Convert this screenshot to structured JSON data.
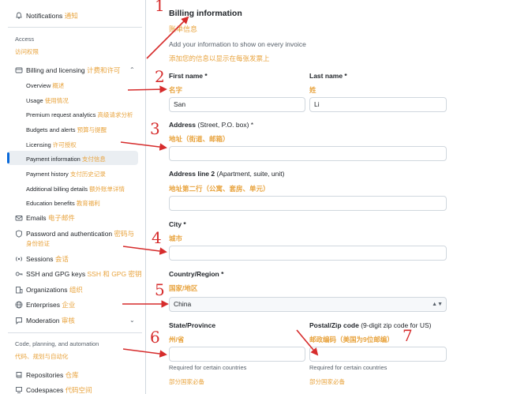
{
  "sidebar": {
    "top_item": {
      "label": "Notifications",
      "zh": "通知"
    },
    "access_heading": "Access",
    "access_heading_zh": "访问权限",
    "billing": {
      "label": "Billing and licensing",
      "zh": "计费和许可"
    },
    "billing_sub": [
      {
        "label": "Overview",
        "zh": "概述"
      },
      {
        "label": "Usage",
        "zh": "使用情况"
      },
      {
        "label": "Premium request analytics",
        "zh": "高级请求分析"
      },
      {
        "label": "Budgets and alerts",
        "zh": "预算与提醒"
      },
      {
        "label": "Licensing",
        "zh": "许可授权"
      },
      {
        "label": "Payment information",
        "zh": "支付信息"
      },
      {
        "label": "Payment history",
        "zh": "支付历史记录"
      },
      {
        "label": "Additional billing details",
        "zh": "额外账单详情"
      },
      {
        "label": "Education benefits",
        "zh": "教育福利"
      }
    ],
    "items": [
      {
        "label": "Emails",
        "zh": "电子邮件"
      },
      {
        "label": "Password and authentication",
        "zh": "密码与",
        "zh2": "身份验证"
      },
      {
        "label": "Sessions",
        "zh": "会话"
      },
      {
        "label": "SSH and GPG keys",
        "zh": "SSH 和 GPG 密钥"
      },
      {
        "label": "Organizations",
        "zh": "组织"
      },
      {
        "label": "Enterprises",
        "zh": "企业"
      },
      {
        "label": "Moderation",
        "zh": "审核"
      }
    ],
    "code_heading": "Code, planning, and automation",
    "code_heading_zh": "代码、规划与自动化",
    "code_items": [
      {
        "label": "Repositories",
        "zh": "仓库"
      },
      {
        "label": "Codespaces",
        "zh": "代码空间"
      }
    ]
  },
  "main": {
    "title": "Billing information",
    "title_zh": "账单信息",
    "subtitle": "Add your information to show on every invoice",
    "subtitle_zh": "添加您的信息以显示在每张发票上",
    "first_name": {
      "label": "First name *",
      "zh": "名字",
      "value": "San"
    },
    "last_name": {
      "label": "Last name *",
      "zh": "姓",
      "value": "Li"
    },
    "address": {
      "label": "Address",
      "label_note": "(Street, P.O. box) *",
      "zh": "地址（街道、邮箱）",
      "value": ""
    },
    "address2": {
      "label": "Address line 2",
      "label_note": "(Apartment, suite, unit)",
      "zh": "地址第二行（公寓、套房、单元）",
      "value": ""
    },
    "city": {
      "label": "City *",
      "zh": "城市",
      "value": ""
    },
    "country": {
      "label": "Country/Region *",
      "zh": "国家/地区",
      "value": "China"
    },
    "state": {
      "label": "State/Province",
      "zh": "州/省",
      "value": "",
      "hint": "Required for certain countries",
      "hint_zh": "部分国家必备"
    },
    "postal": {
      "label": "Postal/Zip code",
      "label_note": "(9-digit zip code for US)",
      "zh": "邮政编码（美国为9位邮编）",
      "value": "",
      "hint": "Required for certain countries",
      "hint_zh": "部分国家必备"
    }
  },
  "annotations": {
    "numbers": [
      "1",
      "2",
      "3",
      "4",
      "5",
      "6",
      "7"
    ],
    "color": "#d62c2c"
  },
  "colors": {
    "accent": "#0969da",
    "translation": "#e8a33d",
    "annotation": "#d62c2c"
  }
}
